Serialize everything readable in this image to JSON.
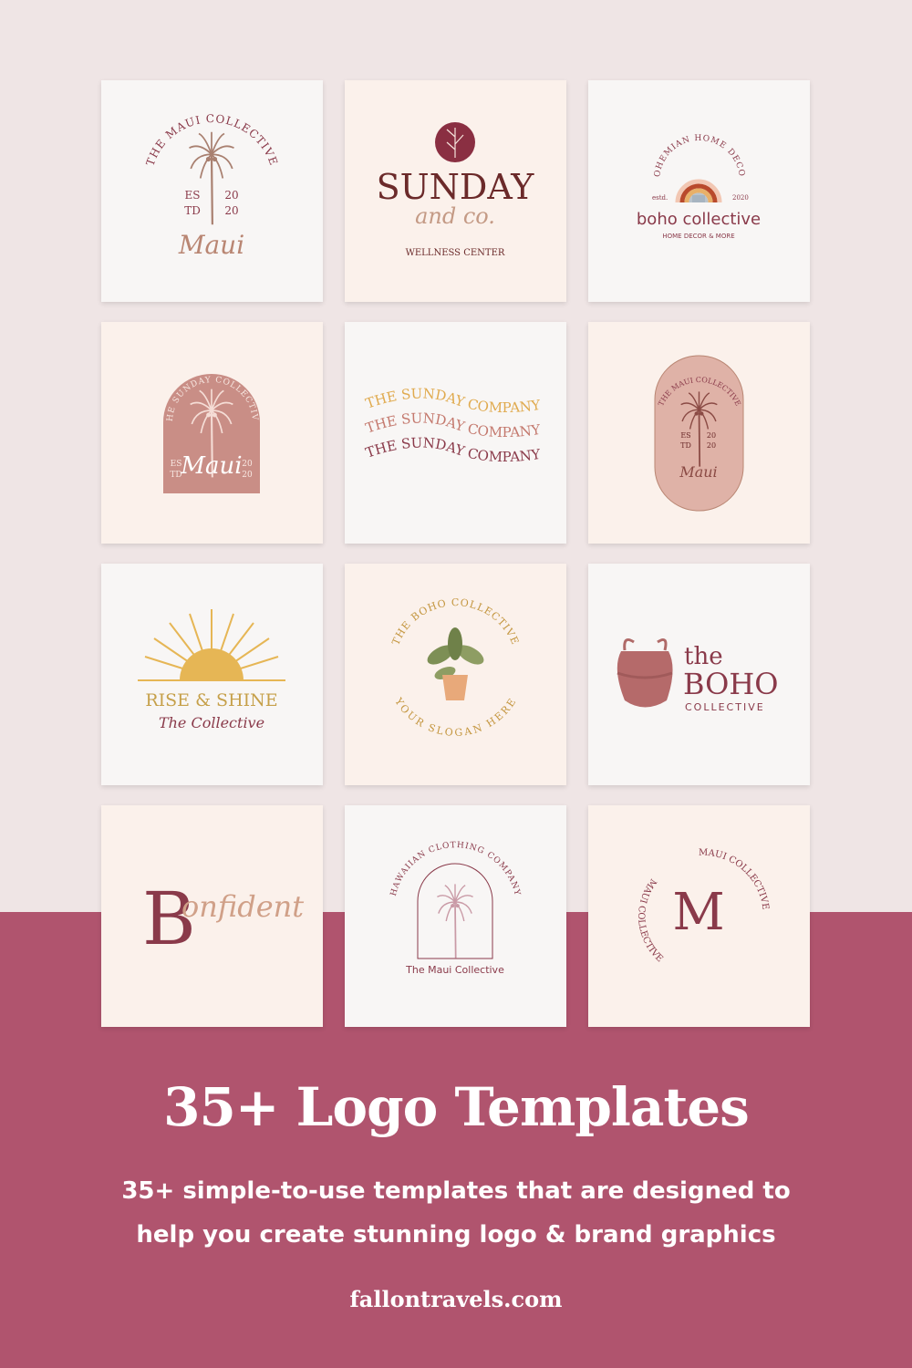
{
  "colors": {
    "background": "#efe5e5",
    "band": "#b0546e",
    "maroon": "#8a3a4a",
    "tan": "#b98673",
    "gold": "#e6b655",
    "dusty_pink": "#c98e86"
  },
  "tiles": [
    {
      "arc": "THE MAUI COLLECTIVE",
      "es": "ES",
      "td": "TD",
      "y1": "20",
      "y2": "20",
      "script": "Maui"
    },
    {
      "title": "SUNDAY",
      "script": "and co.",
      "sub": "WELLNESS CENTER"
    },
    {
      "arc": "BOHEMIAN HOME DECOR",
      "left": "estd.",
      "right": "2020",
      "title": "boho collective",
      "sub": "HOME DECOR & MORE"
    },
    {
      "arc": "THE SUNDAY COLLECTIVE",
      "es": "ES",
      "td": "TD",
      "y1": "20",
      "y2": "20",
      "script": "Maui"
    },
    {
      "lines": [
        "THE SUNDAY COMPANY",
        "THE SUNDAY COMPANY",
        "THE SUNDAY COMPANY"
      ]
    },
    {
      "arc": "THE MAUI COLLECTIVE",
      "es": "ES",
      "td": "TD",
      "y1": "20",
      "y2": "20",
      "script": "Maui"
    },
    {
      "title": "RISE & SHINE",
      "script": "The Collective"
    },
    {
      "arc_top": "THE BOHO COLLECTIVE",
      "arc_bottom": "YOUR SLOGAN HERE"
    },
    {
      "the": "the",
      "title": "BOHO",
      "sub": "COLLECTIVE"
    },
    {
      "letter": "B",
      "script": "onfident"
    },
    {
      "arc": "HAWAIIAN CLOTHING COMPANY",
      "title": "The Maui Collective"
    },
    {
      "letter": "M",
      "arc_top": "MAUI COLLECTIVE",
      "arc_bottom": "MAUI COLLECTIVE"
    }
  ],
  "headline": {
    "title": "35+ Logo Templates",
    "subtitle_line1": "35+ simple-to-use templates that are designed to",
    "subtitle_line2": "help you create stunning logo & brand graphics",
    "url": "fallontravels.com"
  }
}
